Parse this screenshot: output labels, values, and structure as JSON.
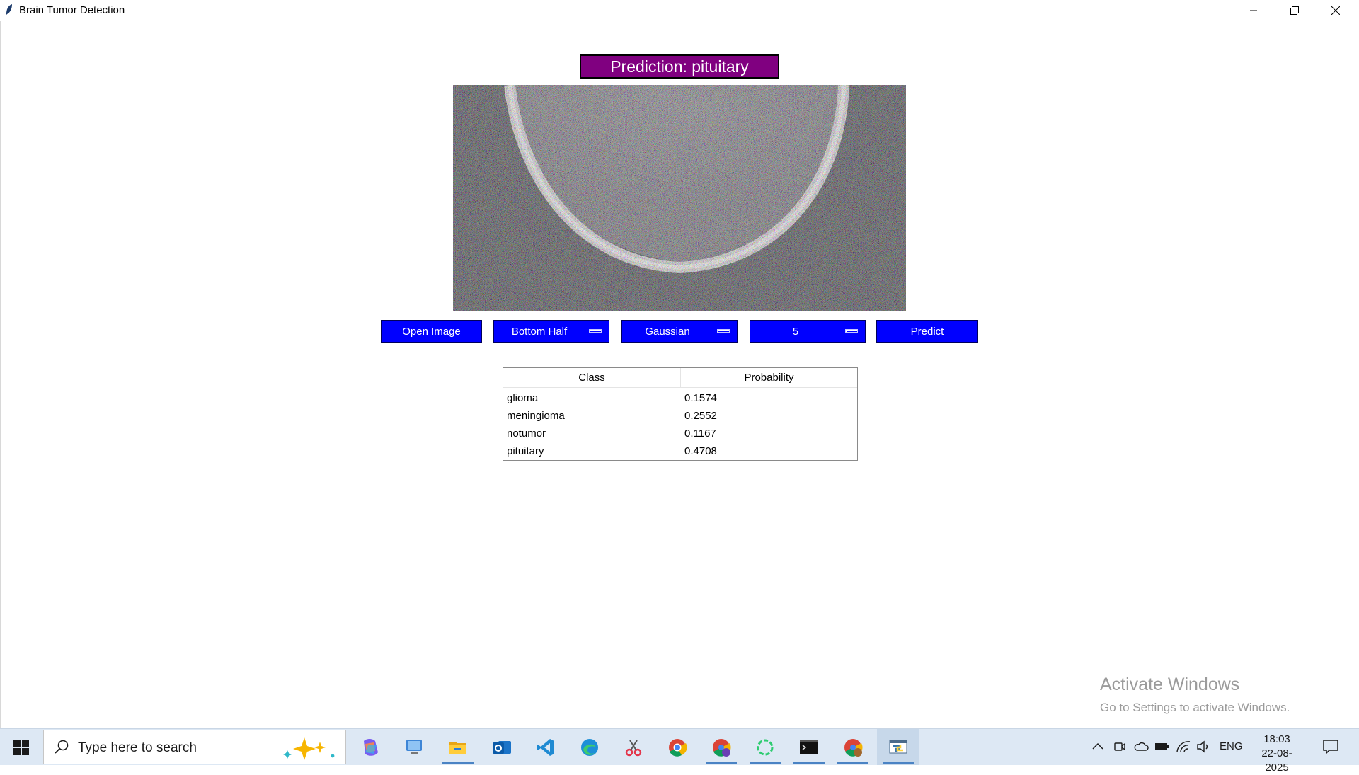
{
  "window": {
    "title": "Brain Tumor Detection"
  },
  "prediction": {
    "label": "Prediction: pituitary"
  },
  "controls": {
    "open_image": "Open Image",
    "region": "Bottom Half",
    "noise": "Gaussian",
    "level": "5",
    "predict": "Predict"
  },
  "table": {
    "headers": [
      "Class",
      "Probability"
    ],
    "rows": [
      {
        "class": "glioma",
        "probability": "0.1574"
      },
      {
        "class": "meningioma",
        "probability": "0.2552"
      },
      {
        "class": "notumor",
        "probability": "0.1167"
      },
      {
        "class": "pituitary",
        "probability": "0.4708"
      }
    ]
  },
  "watermark": {
    "line1": "Activate Windows",
    "line2": "Go to Settings to activate Windows."
  },
  "taskbar": {
    "search_placeholder": "Type here to search",
    "apps": [
      "copilot-icon",
      "desktop-icon",
      "file-explorer-icon",
      "outlook-icon",
      "vscode-icon",
      "edge-icon",
      "snipping-tool-icon",
      "chrome-icon",
      "chrome-profile-icon",
      "loading-app-icon",
      "terminal-icon",
      "chrome-profile-2-icon",
      "python-app-icon"
    ],
    "language": "ENG",
    "time": "18:03",
    "date": "22-08-2025"
  },
  "colors": {
    "prediction_bg": "#800080",
    "button_bg": "#0000ff",
    "taskbar_bg": "#dde8f4"
  }
}
